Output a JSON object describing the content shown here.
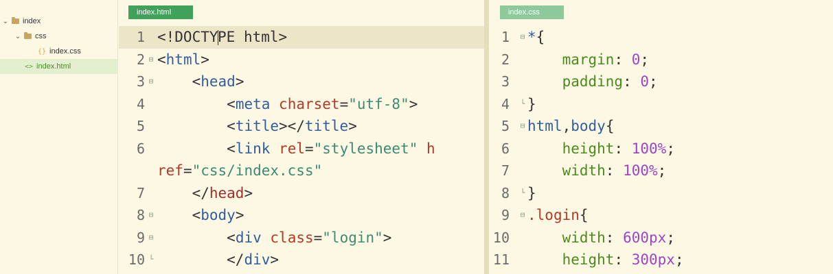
{
  "sidebar": {
    "root_label": "index",
    "css_folder_label": "css",
    "css_file_label": "index.css",
    "html_file_label": "index.html",
    "selected": "index.html"
  },
  "tabs": {
    "left_label": "index.html",
    "right_label": "index.css"
  },
  "colors": {
    "active_tab": "#41a05a",
    "inactive_tab": "#8dc99b",
    "background": "#fdf8e4",
    "tag": "#2f5d9e",
    "attribute": "#b23a25",
    "string": "#3c8a74",
    "property": "#4a8a1e",
    "number": "#9b45c6"
  },
  "html_editor": {
    "current_line": 1,
    "lines": [
      {
        "num": "1",
        "fold": "",
        "tokens": [
          [
            "t-punc",
            "<!DOCTY"
          ],
          [
            "caret",
            ""
          ],
          [
            "t-punc",
            "PE html>"
          ]
        ]
      },
      {
        "num": "2",
        "fold": "⊟",
        "tokens": [
          [
            "t-punc",
            "<"
          ],
          [
            "t-tag",
            "html"
          ],
          [
            "t-punc",
            ">"
          ]
        ]
      },
      {
        "num": "3",
        "fold": "⊟",
        "tokens": [
          [
            "t-plain",
            "    "
          ],
          [
            "t-punc",
            "<"
          ],
          [
            "t-tag",
            "head"
          ],
          [
            "t-punc",
            ">"
          ]
        ]
      },
      {
        "num": "4",
        "fold": "",
        "tokens": [
          [
            "t-plain",
            "        "
          ],
          [
            "t-punc",
            "<"
          ],
          [
            "t-tag",
            "meta"
          ],
          [
            "t-plain",
            " "
          ],
          [
            "t-attr",
            "charset"
          ],
          [
            "t-punc",
            "="
          ],
          [
            "t-str",
            "\"utf-8\""
          ],
          [
            "t-punc",
            ">"
          ]
        ]
      },
      {
        "num": "5",
        "fold": "",
        "tokens": [
          [
            "t-plain",
            "        "
          ],
          [
            "t-punc",
            "<"
          ],
          [
            "t-tag",
            "title"
          ],
          [
            "t-punc",
            "></"
          ],
          [
            "t-tag",
            "title"
          ],
          [
            "t-punc",
            ">"
          ]
        ]
      },
      {
        "num": "6",
        "fold": "",
        "tokens": [
          [
            "t-plain",
            "        "
          ],
          [
            "t-punc",
            "<"
          ],
          [
            "t-tag",
            "link"
          ],
          [
            "t-plain",
            " "
          ],
          [
            "t-attr",
            "rel"
          ],
          [
            "t-punc",
            "="
          ],
          [
            "t-str",
            "\"stylesheet\""
          ],
          [
            "t-plain",
            " "
          ],
          [
            "t-attr",
            "h"
          ]
        ]
      },
      {
        "num": "",
        "fold": "",
        "wrap": true,
        "tokens": [
          [
            "t-attr",
            "ref"
          ],
          [
            "t-punc",
            "="
          ],
          [
            "t-str",
            "\"css/index.css\""
          ]
        ]
      },
      {
        "num": "7",
        "fold": "",
        "tokens": [
          [
            "t-plain",
            "    "
          ],
          [
            "t-punc",
            "</"
          ],
          [
            "t-closetag",
            "head"
          ],
          [
            "t-punc",
            ">"
          ]
        ]
      },
      {
        "num": "8",
        "fold": "⊟",
        "tokens": [
          [
            "t-plain",
            "    "
          ],
          [
            "t-punc",
            "<"
          ],
          [
            "t-tag",
            "body"
          ],
          [
            "t-punc",
            ">"
          ]
        ]
      },
      {
        "num": "9",
        "fold": "⊟",
        "tokens": [
          [
            "t-plain",
            "        "
          ],
          [
            "t-punc",
            "<"
          ],
          [
            "t-tag",
            "div"
          ],
          [
            "t-plain",
            " "
          ],
          [
            "t-attr",
            "class"
          ],
          [
            "t-punc",
            "="
          ],
          [
            "t-str",
            "\"login\""
          ],
          [
            "t-punc",
            ">"
          ]
        ]
      },
      {
        "num": "10",
        "fold": "└",
        "tokens": [
          [
            "t-plain",
            "        "
          ],
          [
            "t-punc",
            "</"
          ],
          [
            "t-tag",
            "div"
          ],
          [
            "t-punc",
            ">"
          ]
        ]
      }
    ]
  },
  "css_editor": {
    "lines": [
      {
        "num": "1",
        "fold": "⊟",
        "tokens": [
          [
            "t-sel",
            "*"
          ],
          [
            "t-punc",
            "{"
          ]
        ]
      },
      {
        "num": "2",
        "fold": "",
        "tokens": [
          [
            "t-plain",
            "    "
          ],
          [
            "t-prop",
            "margin"
          ],
          [
            "t-punc",
            ": "
          ],
          [
            "t-num",
            "0"
          ],
          [
            "t-punc",
            ";"
          ]
        ]
      },
      {
        "num": "3",
        "fold": "",
        "tokens": [
          [
            "t-plain",
            "    "
          ],
          [
            "t-prop",
            "padding"
          ],
          [
            "t-punc",
            ": "
          ],
          [
            "t-num",
            "0"
          ],
          [
            "t-punc",
            ";"
          ]
        ]
      },
      {
        "num": "4",
        "fold": "└",
        "tokens": [
          [
            "t-punc",
            "}"
          ]
        ]
      },
      {
        "num": "5",
        "fold": "⊟",
        "tokens": [
          [
            "t-sel",
            "html"
          ],
          [
            "t-punc",
            ","
          ],
          [
            "t-sel",
            "body"
          ],
          [
            "t-punc",
            "{"
          ]
        ]
      },
      {
        "num": "6",
        "fold": "",
        "tokens": [
          [
            "t-plain",
            "    "
          ],
          [
            "t-prop",
            "height"
          ],
          [
            "t-punc",
            ": "
          ],
          [
            "t-num",
            "100%"
          ],
          [
            "t-punc",
            ";"
          ]
        ]
      },
      {
        "num": "7",
        "fold": "",
        "tokens": [
          [
            "t-plain",
            "    "
          ],
          [
            "t-prop",
            "width"
          ],
          [
            "t-punc",
            ": "
          ],
          [
            "t-num",
            "100%"
          ],
          [
            "t-punc",
            ";"
          ]
        ]
      },
      {
        "num": "8",
        "fold": "└",
        "tokens": [
          [
            "t-punc",
            "}"
          ]
        ]
      },
      {
        "num": "9",
        "fold": "⊟",
        "tokens": [
          [
            "t-attr",
            "."
          ],
          [
            "t-attr",
            "login"
          ],
          [
            "t-punc",
            "{"
          ]
        ]
      },
      {
        "num": "10",
        "fold": "",
        "tokens": [
          [
            "t-plain",
            "    "
          ],
          [
            "t-prop",
            "width"
          ],
          [
            "t-punc",
            ": "
          ],
          [
            "t-num",
            "600px"
          ],
          [
            "t-punc",
            ";"
          ]
        ]
      },
      {
        "num": "11",
        "fold": "",
        "tokens": [
          [
            "t-plain",
            "    "
          ],
          [
            "t-prop",
            "height"
          ],
          [
            "t-punc",
            ": "
          ],
          [
            "t-num",
            "300px"
          ],
          [
            "t-punc",
            ";"
          ]
        ]
      }
    ]
  }
}
